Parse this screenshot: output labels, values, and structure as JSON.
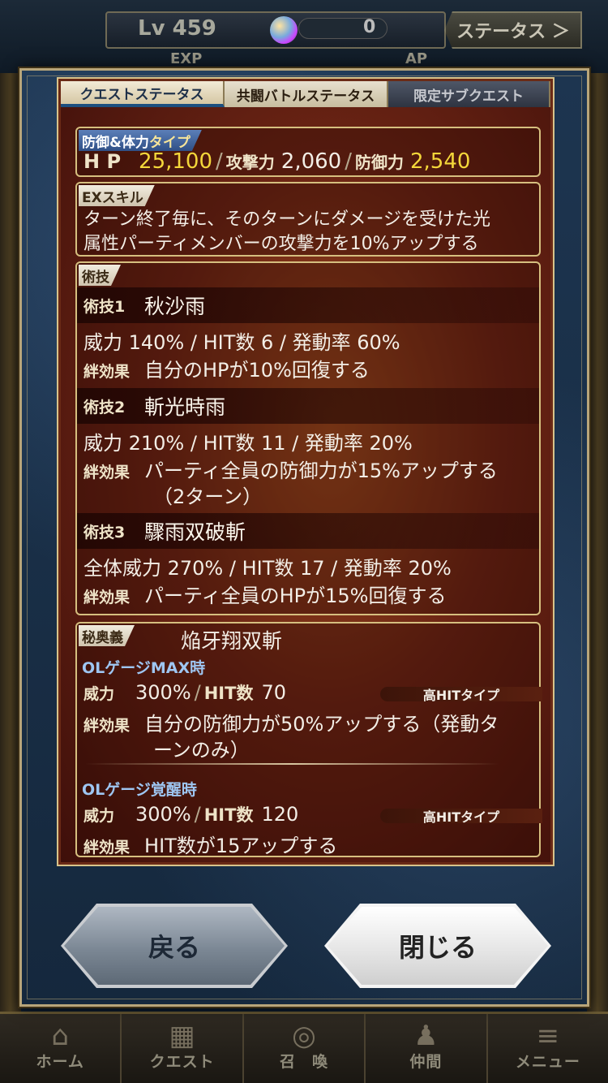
{
  "header": {
    "level": "Lv 459",
    "orb_count": "0",
    "status_button": "ステータス ＞",
    "exp_label": "EXP",
    "ap_label": "AP"
  },
  "tabs": [
    "クエストステータス",
    "共闘バトルステータス",
    "限定サブクエスト"
  ],
  "stats": {
    "type_tag_main": "防御&体力",
    "type_tag_tail": "タイプ",
    "hp_label": "H P",
    "hp_value": "25,100",
    "atk_label": "攻撃力",
    "atk_value": "2,060",
    "def_label": "防御力",
    "def_value": "2,540"
  },
  "ex_skill": {
    "tag": "EXスキル",
    "line1": "ターン終了毎に、そのターンにダメージを受けた光",
    "line2": "属性パーティメンバーの攻撃力を10%アップする"
  },
  "arts": {
    "tag": "術技",
    "skills": [
      {
        "key": "術技1",
        "name": "秋沙雨",
        "stats": "威力 140% / HIT数 6 / 発動率 60%",
        "bond_label": "絆効果",
        "bond": "自分のHPが10%回復する",
        "bond2": ""
      },
      {
        "key": "術技2",
        "name": "斬光時雨",
        "stats": "威力 210% / HIT数 11 / 発動率 20%",
        "bond_label": "絆効果",
        "bond": "パーティ全員の防御力が15%アップする",
        "bond2": "（2ターン）"
      },
      {
        "key": "術技3",
        "name": "驟雨双破斬",
        "stats": "全体威力 270% / HIT数 17 / 発動率 20%",
        "bond_label": "絆効果",
        "bond": "パーティ全員のHPが15%回復する",
        "bond2": ""
      }
    ]
  },
  "ougi": {
    "tag": "秘奥義",
    "name": "焔牙翔双斬",
    "max": {
      "title": "OLゲージMAX時",
      "power_label": "威力",
      "power": "300%",
      "hit_label": "HIT数",
      "hit": "70",
      "hit_type": "高HITタイプ",
      "bond_label": "絆効果",
      "bond": "自分の防御力が50%アップする（発動タ",
      "bond2": "ーンのみ）"
    },
    "awake": {
      "title": "OLゲージ覚醒時",
      "power_label": "威力",
      "power": "300%",
      "hit_label": "HIT数",
      "hit": "120",
      "hit_type": "高HITタイプ",
      "bond_label": "絆効果",
      "bond": "HIT数が15アップする"
    }
  },
  "buttons": {
    "back": "戻る",
    "close": "閉じる"
  },
  "nav": {
    "items": [
      {
        "label": "ホーム",
        "icon": "home-icon"
      },
      {
        "label": "クエスト",
        "icon": "map-icon"
      },
      {
        "label": "召　喚",
        "icon": "summon-icon"
      },
      {
        "label": "仲間",
        "icon": "ally-icon"
      },
      {
        "label": "メニュー",
        "icon": "menu-icon"
      }
    ]
  }
}
